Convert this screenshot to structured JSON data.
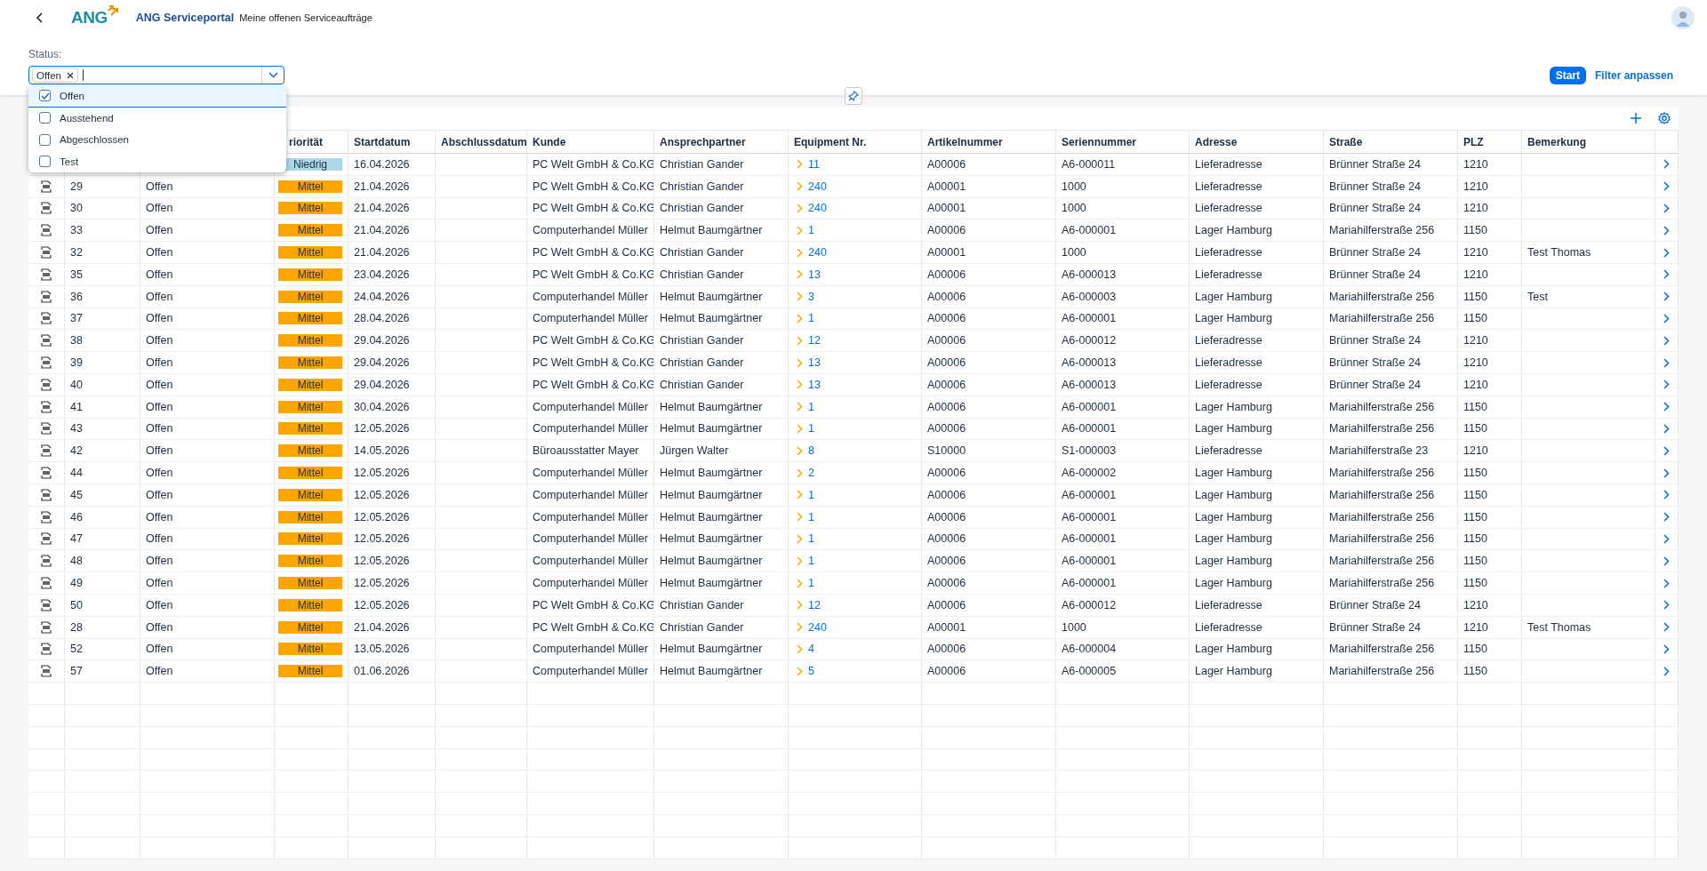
{
  "header": {
    "logo": "ANG",
    "title": "ANG Serviceportal",
    "subtitle": "Meine offenen Serviceaufträge"
  },
  "filter": {
    "label": "Status:",
    "tokens": [
      "Offen"
    ],
    "options": [
      {
        "label": "Offen",
        "checked": true,
        "selected": true
      },
      {
        "label": "Ausstehend",
        "checked": false,
        "selected": false
      },
      {
        "label": "Abgeschlossen",
        "checked": false,
        "selected": false
      },
      {
        "label": "Test",
        "checked": false,
        "selected": false
      }
    ],
    "start": "Start",
    "adapt": "Filter anpassen"
  },
  "table": {
    "columns": [
      "riorität",
      "Startdatum",
      "Abschlussdatum",
      "Kunde",
      "Ansprechpartner",
      "Equipment Nr.",
      "Artikelnummer",
      "Seriennummer",
      "Adresse",
      "Straße",
      "PLZ",
      "Bemerkung"
    ],
    "rows": [
      {
        "hidden_by_dropdown": true,
        "priority": {
          "label": "Niedrig",
          "kind": "low"
        },
        "start": "16.04.2026",
        "customer": "PC Welt GmbH & Co.KG",
        "contact": "Christian Gander",
        "equipment": "11",
        "article": "A00006",
        "serial": "A6-000011",
        "address": "Lieferadresse",
        "street": "Brünner Straße 24",
        "plz": "1210"
      },
      {
        "id": "29",
        "status": "Offen",
        "priority": {
          "label": "Mittel",
          "kind": "medium"
        },
        "start": "21.04.2026",
        "customer": "PC Welt GmbH & Co.KG",
        "contact": "Christian Gander",
        "equipment": "240",
        "article": "A00001",
        "serial": "1000",
        "address": "Lieferadresse",
        "street": "Brünner Straße 24",
        "plz": "1210"
      },
      {
        "id": "30",
        "status": "Offen",
        "priority": {
          "label": "Mittel",
          "kind": "medium"
        },
        "start": "21.04.2026",
        "customer": "PC Welt GmbH & Co.KG",
        "contact": "Christian Gander",
        "equipment": "240",
        "article": "A00001",
        "serial": "1000",
        "address": "Lieferadresse",
        "street": "Brünner Straße 24",
        "plz": "1210"
      },
      {
        "id": "33",
        "status": "Offen",
        "priority": {
          "label": "Mittel",
          "kind": "medium"
        },
        "start": "21.04.2026",
        "customer": "Computerhandel Müller",
        "contact": "Helmut Baumgärtner",
        "equipment": "1",
        "article": "A00006",
        "serial": "A6-000001",
        "address": "Lager Hamburg",
        "street": "Mariahilferstraße 256",
        "plz": "1150"
      },
      {
        "id": "32",
        "status": "Offen",
        "priority": {
          "label": "Mittel",
          "kind": "medium"
        },
        "start": "21.04.2026",
        "customer": "PC Welt GmbH & Co.KG",
        "contact": "Christian Gander",
        "equipment": "240",
        "article": "A00001",
        "serial": "1000",
        "address": "Lieferadresse",
        "street": "Brünner Straße 24",
        "plz": "1210",
        "note": "Test Thomas"
      },
      {
        "id": "35",
        "status": "Offen",
        "priority": {
          "label": "Mittel",
          "kind": "medium"
        },
        "start": "23.04.2026",
        "customer": "PC Welt GmbH & Co.KG",
        "contact": "Christian Gander",
        "equipment": "13",
        "article": "A00006",
        "serial": "A6-000013",
        "address": "Lieferadresse",
        "street": "Brünner Straße 24",
        "plz": "1210"
      },
      {
        "id": "36",
        "status": "Offen",
        "priority": {
          "label": "Mittel",
          "kind": "medium"
        },
        "start": "24.04.2026",
        "customer": "Computerhandel Müller",
        "contact": "Helmut Baumgärtner",
        "equipment": "3",
        "article": "A00006",
        "serial": "A6-000003",
        "address": "Lager Hamburg",
        "street": "Mariahilferstraße 256",
        "plz": "1150",
        "note": "Test"
      },
      {
        "id": "37",
        "status": "Offen",
        "priority": {
          "label": "Mittel",
          "kind": "medium"
        },
        "start": "28.04.2026",
        "customer": "Computerhandel Müller",
        "contact": "Helmut Baumgärtner",
        "equipment": "1",
        "article": "A00006",
        "serial": "A6-000001",
        "address": "Lager Hamburg",
        "street": "Mariahilferstraße 256",
        "plz": "1150"
      },
      {
        "id": "38",
        "status": "Offen",
        "priority": {
          "label": "Mittel",
          "kind": "medium"
        },
        "start": "29.04.2026",
        "customer": "PC Welt GmbH & Co.KG",
        "contact": "Christian Gander",
        "equipment": "12",
        "article": "A00006",
        "serial": "A6-000012",
        "address": "Lieferadresse",
        "street": "Brünner Straße 24",
        "plz": "1210"
      },
      {
        "id": "39",
        "status": "Offen",
        "priority": {
          "label": "Mittel",
          "kind": "medium"
        },
        "start": "29.04.2026",
        "customer": "PC Welt GmbH & Co.KG",
        "contact": "Christian Gander",
        "equipment": "13",
        "article": "A00006",
        "serial": "A6-000013",
        "address": "Lieferadresse",
        "street": "Brünner Straße 24",
        "plz": "1210"
      },
      {
        "id": "40",
        "status": "Offen",
        "priority": {
          "label": "Mittel",
          "kind": "medium"
        },
        "start": "29.04.2026",
        "customer": "PC Welt GmbH & Co.KG",
        "contact": "Christian Gander",
        "equipment": "13",
        "article": "A00006",
        "serial": "A6-000013",
        "address": "Lieferadresse",
        "street": "Brünner Straße 24",
        "plz": "1210"
      },
      {
        "id": "41",
        "status": "Offen",
        "priority": {
          "label": "Mittel",
          "kind": "medium"
        },
        "start": "30.04.2026",
        "customer": "Computerhandel Müller",
        "contact": "Helmut Baumgärtner",
        "equipment": "1",
        "article": "A00006",
        "serial": "A6-000001",
        "address": "Lager Hamburg",
        "street": "Mariahilferstraße 256",
        "plz": "1150"
      },
      {
        "id": "43",
        "status": "Offen",
        "priority": {
          "label": "Mittel",
          "kind": "medium"
        },
        "start": "12.05.2026",
        "customer": "Computerhandel Müller",
        "contact": "Helmut Baumgärtner",
        "equipment": "1",
        "article": "A00006",
        "serial": "A6-000001",
        "address": "Lager Hamburg",
        "street": "Mariahilferstraße 256",
        "plz": "1150"
      },
      {
        "id": "42",
        "status": "Offen",
        "priority": {
          "label": "Mittel",
          "kind": "medium"
        },
        "start": "14.05.2026",
        "customer": "Büroausstatter Mayer",
        "contact": "Jürgen Walter",
        "equipment": "8",
        "article": "S10000",
        "serial": "S1-000003",
        "address": "Lieferadresse",
        "street": "Mariahilferstraße 23",
        "plz": "1210"
      },
      {
        "id": "44",
        "status": "Offen",
        "priority": {
          "label": "Mittel",
          "kind": "medium"
        },
        "start": "12.05.2026",
        "customer": "Computerhandel Müller",
        "contact": "Helmut Baumgärtner",
        "equipment": "2",
        "article": "A00006",
        "serial": "A6-000002",
        "address": "Lager Hamburg",
        "street": "Mariahilferstraße 256",
        "plz": "1150"
      },
      {
        "id": "45",
        "status": "Offen",
        "priority": {
          "label": "Mittel",
          "kind": "medium"
        },
        "start": "12.05.2026",
        "customer": "Computerhandel Müller",
        "contact": "Helmut Baumgärtner",
        "equipment": "1",
        "article": "A00006",
        "serial": "A6-000001",
        "address": "Lager Hamburg",
        "street": "Mariahilferstraße 256",
        "plz": "1150"
      },
      {
        "id": "46",
        "status": "Offen",
        "priority": {
          "label": "Mittel",
          "kind": "medium"
        },
        "start": "12.05.2026",
        "customer": "Computerhandel Müller",
        "contact": "Helmut Baumgärtner",
        "equipment": "1",
        "article": "A00006",
        "serial": "A6-000001",
        "address": "Lager Hamburg",
        "street": "Mariahilferstraße 256",
        "plz": "1150"
      },
      {
        "id": "47",
        "status": "Offen",
        "priority": {
          "label": "Mittel",
          "kind": "medium"
        },
        "start": "12.05.2026",
        "customer": "Computerhandel Müller",
        "contact": "Helmut Baumgärtner",
        "equipment": "1",
        "article": "A00006",
        "serial": "A6-000001",
        "address": "Lager Hamburg",
        "street": "Mariahilferstraße 256",
        "plz": "1150"
      },
      {
        "id": "48",
        "status": "Offen",
        "priority": {
          "label": "Mittel",
          "kind": "medium"
        },
        "start": "12.05.2026",
        "customer": "Computerhandel Müller",
        "contact": "Helmut Baumgärtner",
        "equipment": "1",
        "article": "A00006",
        "serial": "A6-000001",
        "address": "Lager Hamburg",
        "street": "Mariahilferstraße 256",
        "plz": "1150"
      },
      {
        "id": "49",
        "status": "Offen",
        "priority": {
          "label": "Mittel",
          "kind": "medium"
        },
        "start": "12.05.2026",
        "customer": "Computerhandel Müller",
        "contact": "Helmut Baumgärtner",
        "equipment": "1",
        "article": "A00006",
        "serial": "A6-000001",
        "address": "Lager Hamburg",
        "street": "Mariahilferstraße 256",
        "plz": "1150"
      },
      {
        "id": "50",
        "status": "Offen",
        "priority": {
          "label": "Mittel",
          "kind": "medium"
        },
        "start": "12.05.2026",
        "customer": "PC Welt GmbH & Co.KG",
        "contact": "Christian Gander",
        "equipment": "12",
        "article": "A00006",
        "serial": "A6-000012",
        "address": "Lieferadresse",
        "street": "Brünner Straße 24",
        "plz": "1210"
      },
      {
        "id": "28",
        "status": "Offen",
        "priority": {
          "label": "Mittel",
          "kind": "medium"
        },
        "start": "21.04.2026",
        "customer": "PC Welt GmbH & Co.KG",
        "contact": "Christian Gander",
        "equipment": "240",
        "article": "A00001",
        "serial": "1000",
        "address": "Lieferadresse",
        "street": "Brünner Straße 24",
        "plz": "1210",
        "note": "Test Thomas"
      },
      {
        "id": "52",
        "status": "Offen",
        "priority": {
          "label": "Mittel",
          "kind": "medium"
        },
        "start": "13.05.2026",
        "customer": "Computerhandel Müller",
        "contact": "Helmut Baumgärtner",
        "equipment": "4",
        "article": "A00006",
        "serial": "A6-000004",
        "address": "Lager Hamburg",
        "street": "Mariahilferstraße 256",
        "plz": "1150"
      },
      {
        "id": "57",
        "status": "Offen",
        "priority": {
          "label": "Mittel",
          "kind": "medium"
        },
        "start": "01.06.2026",
        "customer": "Computerhandel Müller",
        "contact": "Helmut Baumgärtner",
        "equipment": "5",
        "article": "A00006",
        "serial": "A6-000005",
        "address": "Lager Hamburg",
        "street": "Mariahilferstraße 256",
        "plz": "1150"
      }
    ]
  }
}
